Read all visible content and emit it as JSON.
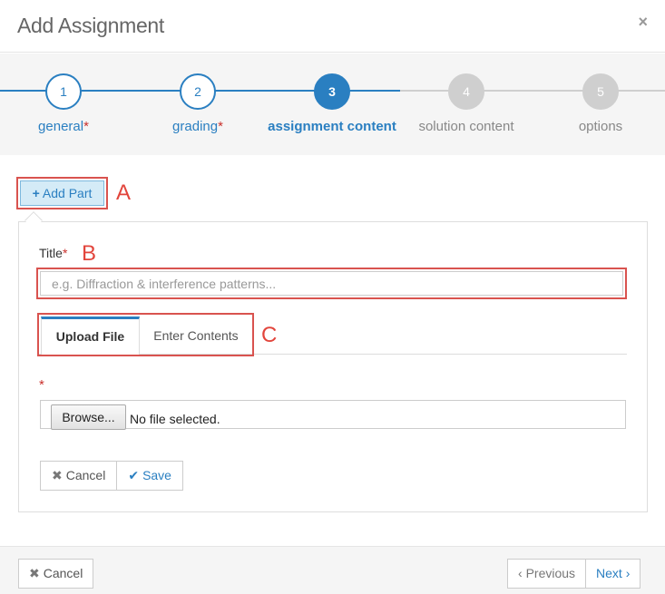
{
  "modal": {
    "title": "Add Assignment",
    "close_symbol": "×"
  },
  "wizard": {
    "steps": [
      {
        "number": "1",
        "label": "general",
        "required": "*",
        "state": "done"
      },
      {
        "number": "2",
        "label": "grading",
        "required": "*",
        "state": "done"
      },
      {
        "number": "3",
        "label": "assignment content",
        "required": "",
        "state": "active"
      },
      {
        "number": "4",
        "label": "solution content",
        "required": "",
        "state": "todo"
      },
      {
        "number": "5",
        "label": "options",
        "required": "",
        "state": "todo"
      }
    ],
    "colors": {
      "active": "#2a7fc1",
      "inactive": "#cfcfcf"
    }
  },
  "add_part": {
    "label": "Add Part",
    "icon": "plus-icon"
  },
  "annotations": {
    "a": "A",
    "b": "B",
    "c": "C"
  },
  "form": {
    "title_label": "Title",
    "title_required": "*",
    "title_placeholder": "e.g. Diffraction & interference patterns...",
    "tabs": [
      {
        "label": "Upload File",
        "active": true
      },
      {
        "label": "Enter Contents",
        "active": false
      }
    ],
    "file_required": "*",
    "browse_label": "Browse...",
    "file_status": "No file selected.",
    "cancel_label": "Cancel",
    "save_label": "Save"
  },
  "footer": {
    "cancel_label": "Cancel",
    "previous_label": "Previous",
    "next_label": "Next"
  }
}
